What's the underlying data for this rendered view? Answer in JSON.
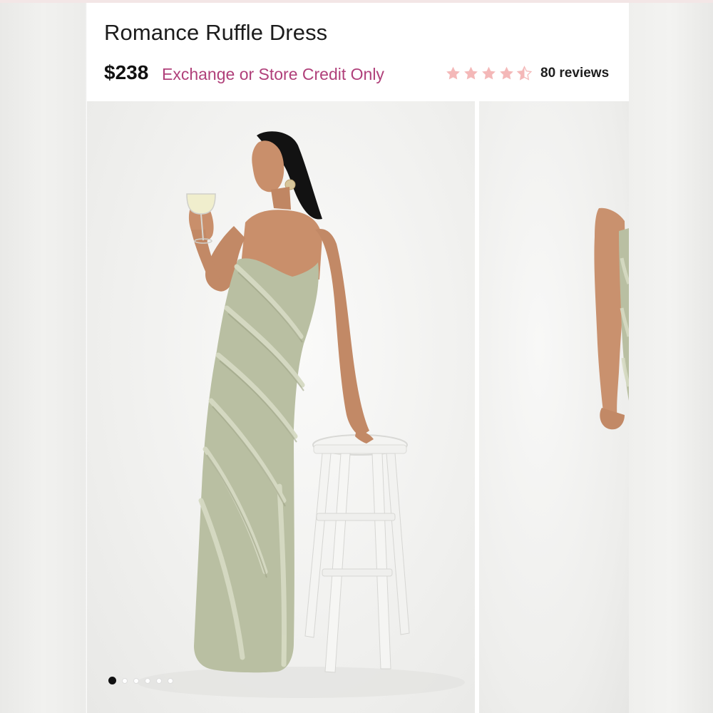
{
  "product": {
    "title": "Romance Ruffle Dress",
    "price": "$238",
    "policy": "Exchange or Store Credit Only"
  },
  "rating": {
    "stars": 4.5,
    "max_stars": 5,
    "star_color": "#f4b8b8",
    "reviews_label": "80 reviews"
  },
  "gallery": {
    "slide_count": 6,
    "active_slide": 1,
    "images": [
      {
        "icon": "model-photo-front"
      },
      {
        "icon": "model-photo-side"
      }
    ]
  },
  "colors": {
    "policy_text": "#b0407a",
    "dress": "#b9bfa2"
  }
}
